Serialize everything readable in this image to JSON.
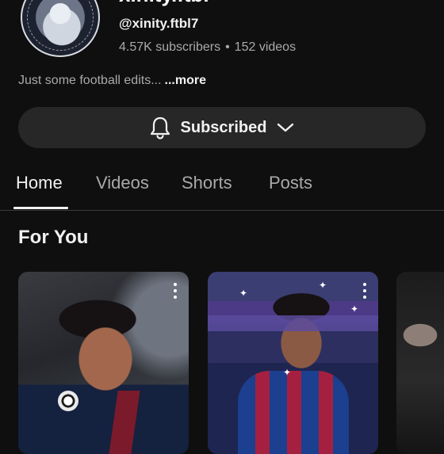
{
  "channel": {
    "name": "xinity.ftbl",
    "handle": "@xinity.ftbl7",
    "subscribers": "4.57K subscribers",
    "separator": "•",
    "videos": "152 videos",
    "description": "Just some football edits...",
    "more_label": "...more"
  },
  "subscribe_button": {
    "label": "Subscribed",
    "bell_icon": "bell-icon",
    "chevron_icon": "chevron-down-icon"
  },
  "tabs": [
    {
      "label": "Home",
      "active": true
    },
    {
      "label": "Videos",
      "active": false
    },
    {
      "label": "Shorts",
      "active": false
    },
    {
      "label": "Posts",
      "active": false
    }
  ],
  "section": {
    "title": "For You"
  },
  "colors": {
    "background": "#0f0f0f",
    "button_bg": "#272727",
    "text_primary": "#f1f1f1",
    "text_secondary": "#aaaaaa"
  }
}
